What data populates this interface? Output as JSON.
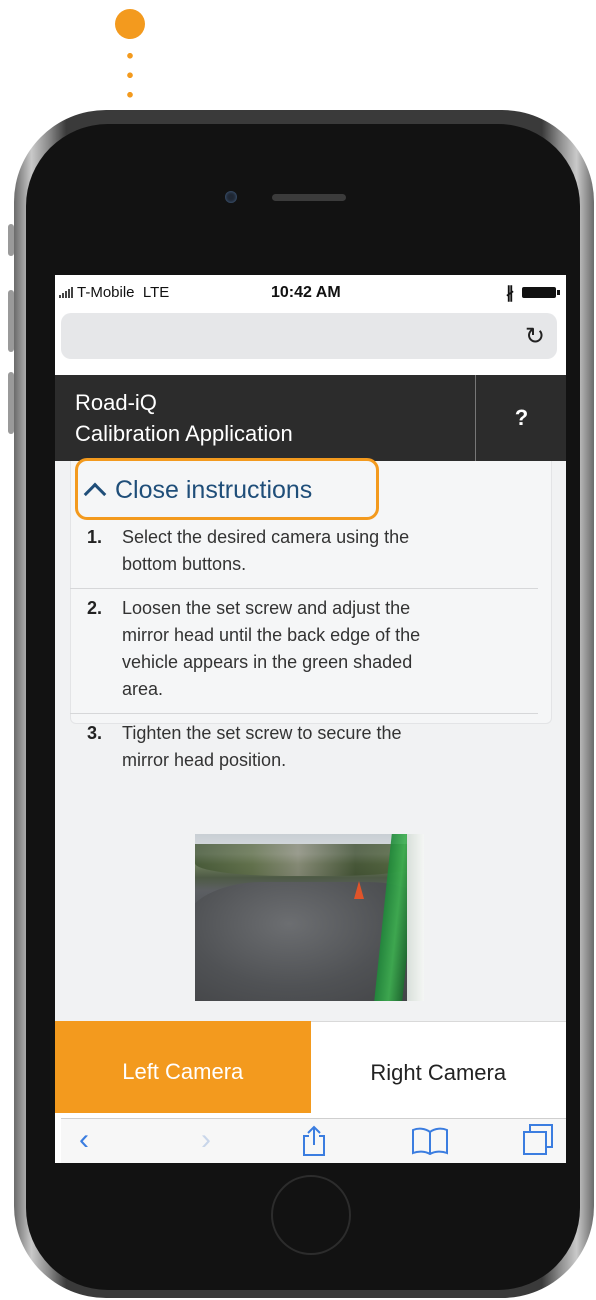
{
  "status_bar": {
    "carrier": "T-Mobile",
    "network": "LTE",
    "time": "10:42 AM"
  },
  "app_header": {
    "title_line1": "Road-iQ",
    "title_line2": "Calibration Application",
    "help_label": "?"
  },
  "instructions": {
    "toggle_label": "Close instructions",
    "steps": [
      {
        "number": "1.",
        "lines": [
          "Select the desired camera using the",
          "bottom buttons."
        ]
      },
      {
        "number": "2.",
        "lines": [
          "Loosen the set screw and adjust the",
          "mirror head until the back edge of the",
          "vehicle appears in the green shaded",
          "area."
        ]
      },
      {
        "number": "3.",
        "lines": [
          "Tighten the set screw to secure the",
          "mirror head position."
        ]
      }
    ]
  },
  "camera_buttons": {
    "left_label": "Left Camera",
    "right_label": "Right Camera",
    "selected": "left"
  },
  "toolbar": {
    "icons": [
      "back-icon",
      "forward-icon",
      "share-icon",
      "bookmarks-icon",
      "tabs-icon"
    ]
  },
  "colors": {
    "accent": "#f39a1e",
    "header_bg": "#2c2c2c",
    "link": "#1f4e79",
    "toolbar_icon": "#3b7de0"
  }
}
